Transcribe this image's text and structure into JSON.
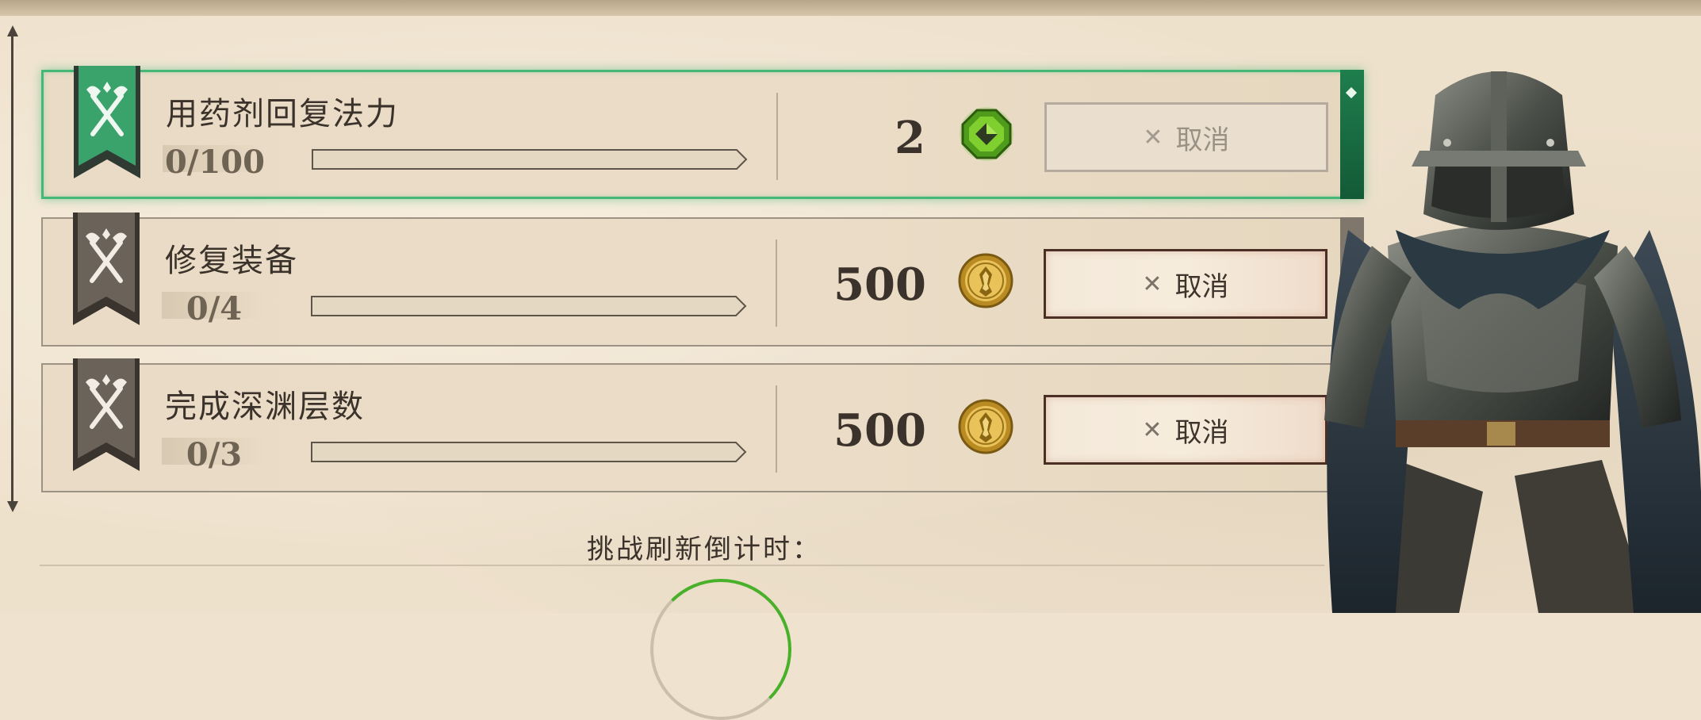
{
  "quests": [
    {
      "title": "用药剂回复法力",
      "progress_text": "0/100",
      "progress": 0,
      "reward_amount": "2",
      "reward_icon": "green-gem-icon",
      "cancel_label": "取消",
      "active": true,
      "banner_color": "#3aa26b"
    },
    {
      "title": "修复装备",
      "progress_text": "0/4",
      "progress": 0,
      "reward_amount": "500",
      "reward_icon": "gold-coin-icon",
      "cancel_label": "取消",
      "active": false,
      "banner_color": "#6b6259"
    },
    {
      "title": "完成深渊层数",
      "progress_text": "0/3",
      "progress": 0,
      "reward_amount": "500",
      "reward_icon": "gold-coin-icon",
      "cancel_label": "取消",
      "active": false,
      "banner_color": "#6b6259"
    }
  ],
  "footer": {
    "countdown_label": "挑战刷新倒计时："
  },
  "colors": {
    "active_border": "#45b777",
    "cancel_border": "#4b2f25",
    "parchment": "#eee1cc"
  }
}
